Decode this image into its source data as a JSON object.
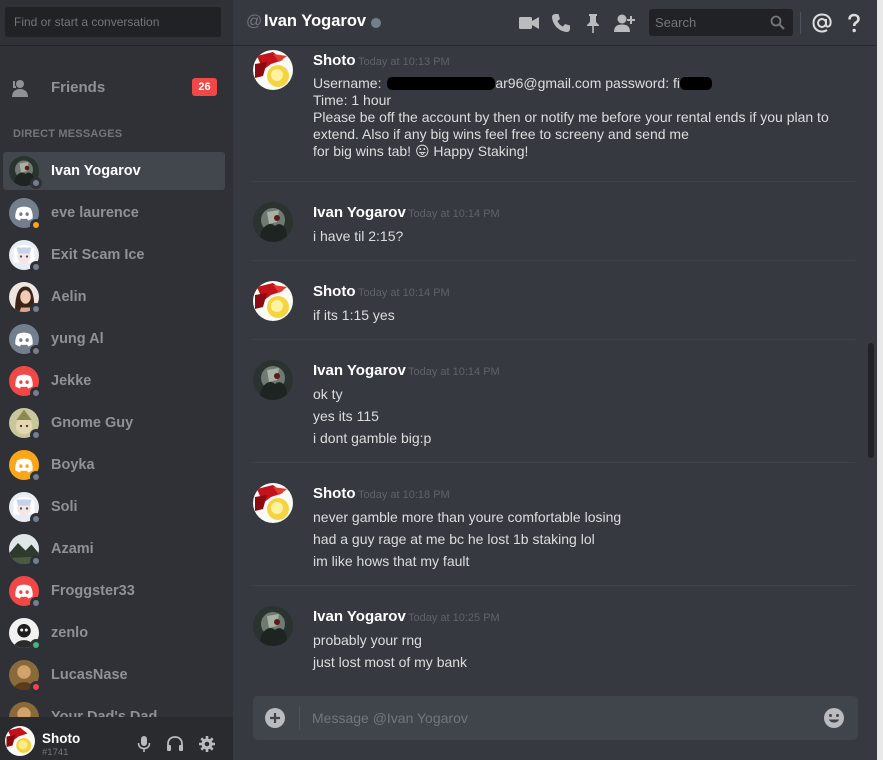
{
  "sidebar": {
    "search_placeholder": "Find or start a conversation",
    "friends_label": "Friends",
    "friends_badge": "26",
    "dm_header": "DIRECT MESSAGES",
    "dms": [
      {
        "name": "Ivan Yogarov",
        "status": "#747f8d",
        "avatar": "dark-scene"
      },
      {
        "name": "eve laurence",
        "status": "#faa61a",
        "avatar": "discord-grey"
      },
      {
        "name": "Exit Scam Ice",
        "status": "#747f8d",
        "avatar": "anime-white"
      },
      {
        "name": "Aelin",
        "status": "#747f8d",
        "avatar": "portrait"
      },
      {
        "name": "yung Al",
        "status": "#747f8d",
        "avatar": "discord-grey"
      },
      {
        "name": "Jekke",
        "status": "#747f8d",
        "avatar": "discord-red"
      },
      {
        "name": "Gnome Guy",
        "status": "#747f8d",
        "avatar": "gnome"
      },
      {
        "name": "Boyka",
        "status": "#747f8d",
        "avatar": "discord-orange"
      },
      {
        "name": "Soli",
        "status": "#747f8d",
        "avatar": "anime-white"
      },
      {
        "name": "Azami",
        "status": "#747f8d",
        "avatar": "landscape"
      },
      {
        "name": "Froggster33",
        "status": "#747f8d",
        "avatar": "discord-red"
      },
      {
        "name": "zenlo",
        "status": "#43b581",
        "avatar": "mono"
      },
      {
        "name": "LucasNase",
        "status": "#f04747",
        "avatar": "brown"
      },
      {
        "name": "Your Dad's Dad",
        "status": "#747f8d",
        "avatar": "brown"
      }
    ]
  },
  "user_panel": {
    "name": "Shoto",
    "tag": "#1741"
  },
  "header": {
    "at": "@",
    "channel_name": "Ivan Yogarov",
    "search_placeholder": "Search"
  },
  "messages": [
    {
      "author": "Shoto",
      "time": "Today at 10:13 PM",
      "avatar": "shoto",
      "lines": [
        {
          "parts": [
            "Username: ",
            "[redacted]",
            "ar96@gmail.com   password: fi",
            "[redacted]"
          ]
        },
        {
          "text": "Time: 1 hour"
        },
        {
          "text": "Please be off the account by then or notify me before your rental ends if you plan to"
        },
        {
          "text": "extend. Also if any big wins feel free to screeny and send me"
        },
        {
          "text": "for big wins tab! 😛 Happy Staking!"
        }
      ]
    },
    {
      "author": "Ivan Yogarov",
      "time": "Today at 10:14 PM",
      "avatar": "dark-scene",
      "lines": [
        {
          "text": "i have til 2:15?"
        }
      ]
    },
    {
      "author": "Shoto",
      "time": "Today at 10:14 PM",
      "avatar": "shoto",
      "lines": [
        {
          "text": "if its 1:15 yes"
        }
      ]
    },
    {
      "author": "Ivan Yogarov",
      "time": "Today at 10:14 PM",
      "avatar": "dark-scene",
      "lines": [
        {
          "text": "ok ty"
        },
        {
          "text": "yes its 115"
        },
        {
          "text": "i dont gamble big:p"
        }
      ]
    },
    {
      "author": "Shoto",
      "time": "Today at 10:18 PM",
      "avatar": "shoto",
      "lines": [
        {
          "text": "never gamble more than youre comfortable losing"
        },
        {
          "text": "had a guy rage at me bc he lost 1b staking lol"
        },
        {
          "text": "im like hows that my fault"
        }
      ]
    },
    {
      "author": "Ivan Yogarov",
      "time": "Today at 10:25 PM",
      "avatar": "dark-scene",
      "lines": [
        {
          "text": "probably your rng"
        },
        {
          "text": "just lost most of my bank"
        }
      ]
    }
  ],
  "composer": {
    "placeholder": "Message @Ivan Yogarov"
  },
  "colors": {
    "accent_red_badge": "#f04747",
    "online": "#43b581",
    "idle": "#faa61a",
    "offline": "#747f8d"
  }
}
